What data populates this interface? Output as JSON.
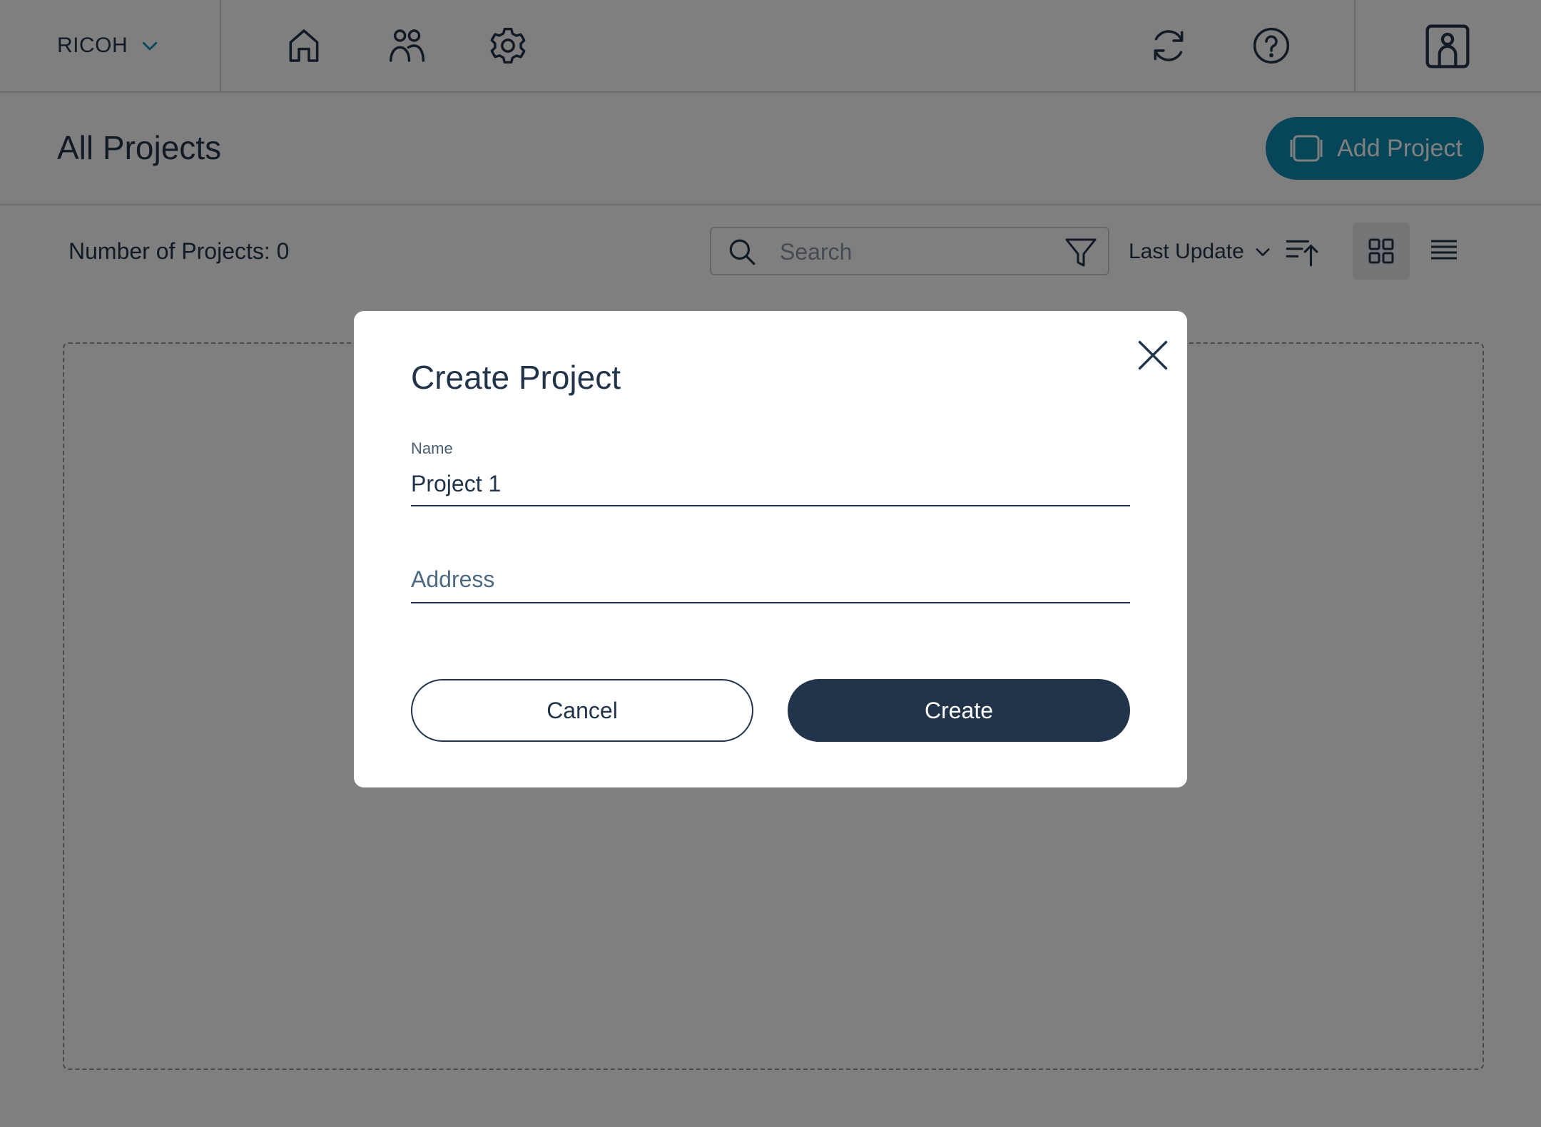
{
  "header": {
    "org_name": "RICOH",
    "icons": [
      "chevron-down-icon",
      "home-icon",
      "users-icon",
      "gear-icon",
      "refresh-icon",
      "help-icon",
      "user-profile-icon"
    ]
  },
  "page": {
    "title": "All Projects",
    "add_project_label": "Add Project"
  },
  "toolbar": {
    "count_label": "Number of Projects: 0",
    "search_placeholder": "Search",
    "sort_label": "Last Update"
  },
  "empty_state": {
    "text": ""
  },
  "modal": {
    "title": "Create Project",
    "name_label": "Name",
    "name_value": "Project 1",
    "address_placeholder": "Address",
    "cancel_label": "Cancel",
    "create_label": "Create"
  },
  "colors": {
    "primary": "#22344a",
    "accent": "#0d8cb0",
    "overlay": "rgba(0,0,0,0.5)"
  }
}
